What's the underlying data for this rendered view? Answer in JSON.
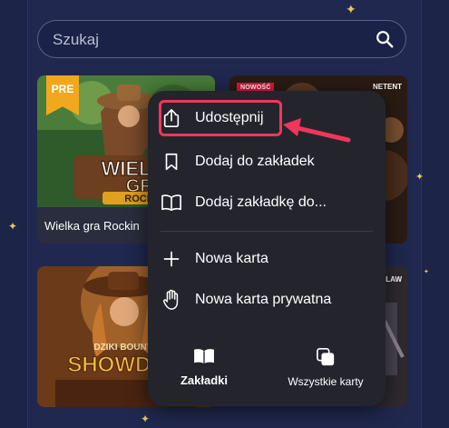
{
  "search": {
    "placeholder": "Szukaj"
  },
  "games": [
    {
      "caption": "Wielka gra Rockin",
      "badge": "PRE",
      "art_lines": [
        "WIELKA",
        "GRA",
        "ROCKIN"
      ]
    },
    {
      "badge": "NOWOŚĆ",
      "provider": "NETENT"
    },
    {
      "art_lines": [
        "DZIKI BOUNTY",
        "SHOWDOW"
      ]
    },
    {
      "provider": "LAW"
    }
  ],
  "menu": {
    "items": [
      {
        "label": "Udostępnij",
        "icon": "share-icon"
      },
      {
        "label": "Dodaj do zakładek",
        "icon": "bookmark-icon"
      },
      {
        "label": "Dodaj zakładkę do...",
        "icon": "open-book-icon"
      },
      {
        "label": "Nowa karta",
        "icon": "plus-icon"
      },
      {
        "label": "Nowa karta prywatna",
        "icon": "hand-icon"
      }
    ],
    "tabs": [
      {
        "label": "Zakładki",
        "icon": "bookmarks-book-icon"
      },
      {
        "label": "Wszystkie karty",
        "icon": "tabs-icon"
      }
    ]
  },
  "colors": {
    "highlight": "#f0365a",
    "menu_bg": "#24252c",
    "page_bg": "#20284f",
    "pre_badge": "#f2a81d",
    "new_badge": "#e3173e"
  }
}
